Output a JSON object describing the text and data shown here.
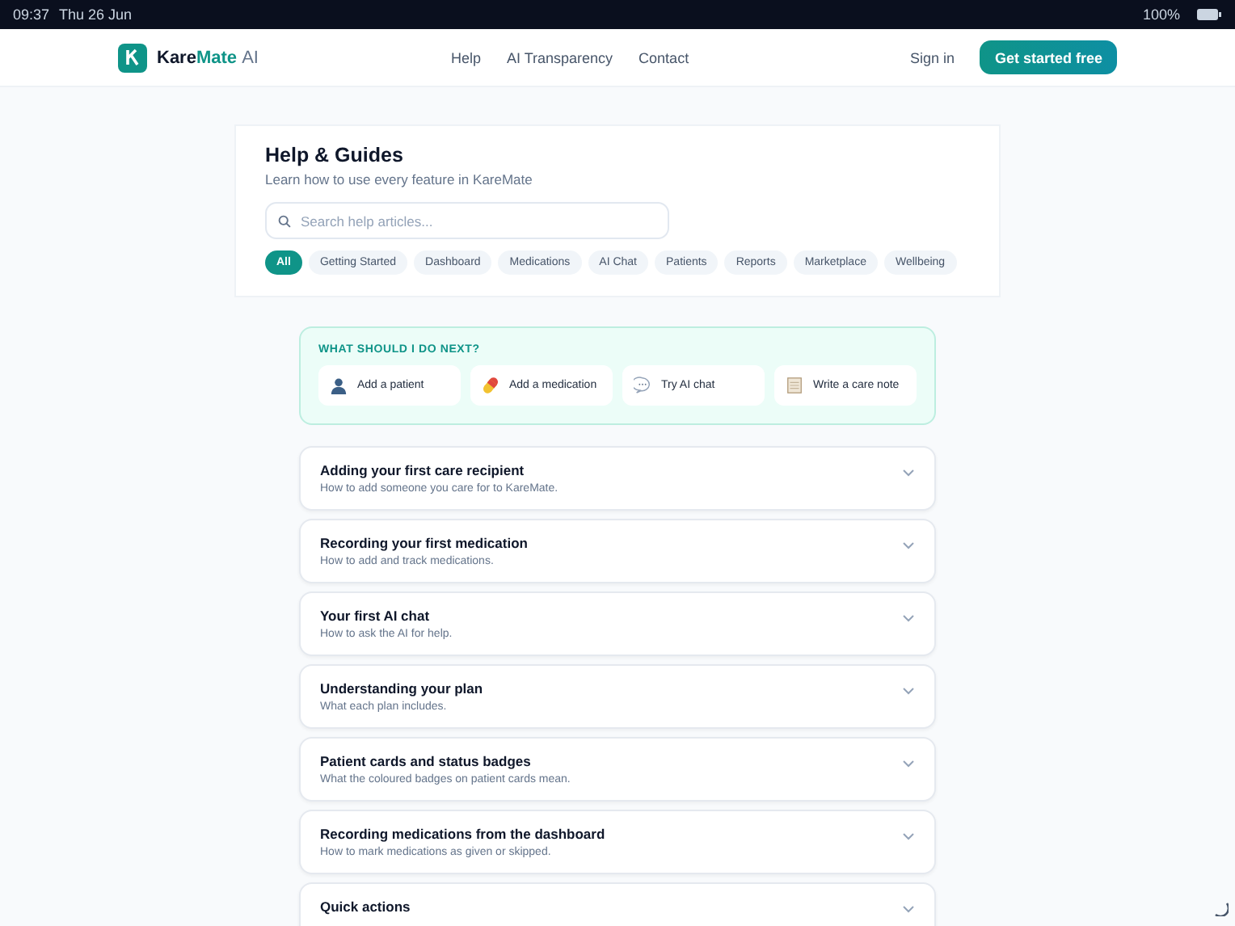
{
  "status_bar": {
    "time": "09:37",
    "date": "Thu 26 Jun",
    "battery": "100%"
  },
  "nav": {
    "brand_main": "Kare",
    "brand_accent": "Mate",
    "brand_suffix": "AI",
    "links": [
      "Help",
      "AI Transparency",
      "Contact"
    ],
    "sign_in": "Sign in",
    "cta": "Get started free"
  },
  "help": {
    "title": "Help & Guides",
    "subtitle": "Learn how to use every feature in KareMate",
    "search": {
      "placeholder": "Search help articles..."
    },
    "filters": [
      {
        "label": "All",
        "selected": true
      },
      {
        "label": "Getting Started",
        "selected": false
      },
      {
        "label": "Dashboard",
        "selected": false
      },
      {
        "label": "Medications",
        "selected": false
      },
      {
        "label": "AI Chat",
        "selected": false
      },
      {
        "label": "Patients",
        "selected": false
      },
      {
        "label": "Reports",
        "selected": false
      },
      {
        "label": "Marketplace",
        "selected": false
      },
      {
        "label": "Wellbeing",
        "selected": false
      }
    ]
  },
  "next_steps": {
    "title": "WHAT SHOULD I DO NEXT?",
    "actions": [
      {
        "kind": "person",
        "label": "Add a patient"
      },
      {
        "kind": "pill",
        "label": "Add a medication"
      },
      {
        "kind": "chat",
        "label": "Try AI chat"
      },
      {
        "kind": "note",
        "label": "Write a care note"
      }
    ]
  },
  "articles": [
    {
      "title": "Adding your first care recipient",
      "summary": "How to add someone you care for to KareMate.",
      "expanded": false
    },
    {
      "title": "Recording your first medication",
      "summary": "How to add and track medications.",
      "expanded": false
    },
    {
      "title": "Your first AI chat",
      "summary": "How to ask the AI for help.",
      "expanded": false
    },
    {
      "title": "Understanding your plan",
      "summary": "What each plan includes.",
      "expanded": false
    },
    {
      "title": "Patient cards and status badges",
      "summary": "What the coloured badges on patient cards mean.",
      "expanded": false
    },
    {
      "title": "Recording medications from the dashboard",
      "summary": "How to mark medications as given or skipped.",
      "expanded": false
    },
    {
      "title": "Quick actions",
      "expanded": false
    }
  ]
}
